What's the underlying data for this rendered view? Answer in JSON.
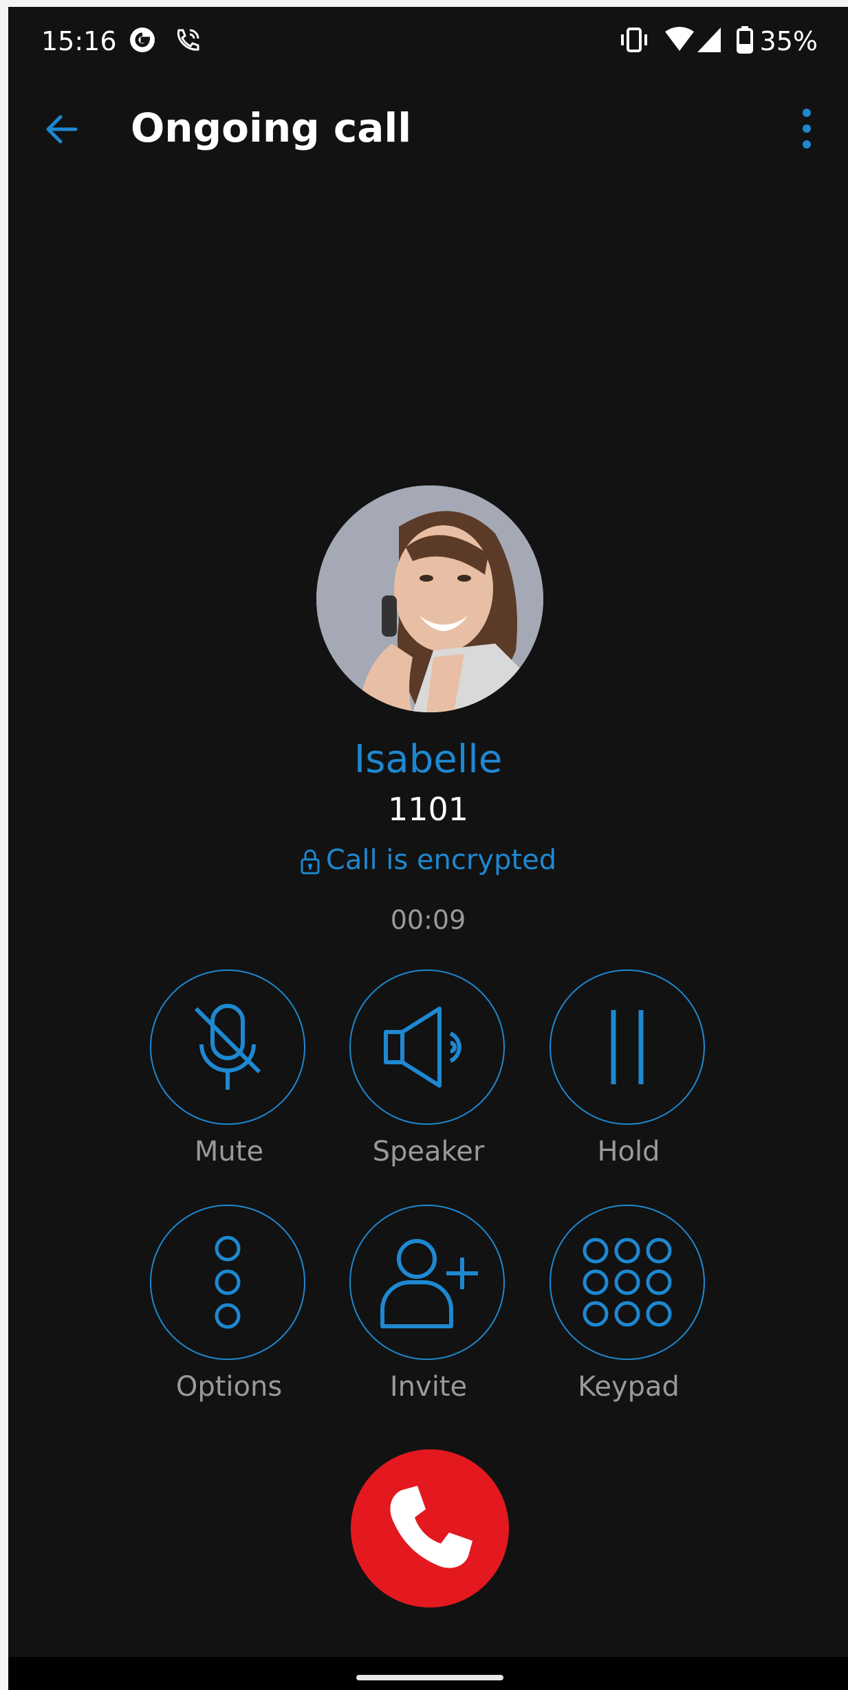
{
  "status_bar": {
    "time": "15:16",
    "battery": "35%",
    "icons": [
      "google-icon",
      "wifi-call-icon",
      "vibrate-icon",
      "wifi-icon",
      "signal-icon",
      "battery-icon"
    ]
  },
  "app_bar": {
    "title": "Ongoing call",
    "icons": [
      "back-arrow-icon",
      "more-vert-icon"
    ]
  },
  "contact": {
    "name": "Isabelle",
    "number": "1101",
    "encryption": "Call is encrypted",
    "duration": "00:09"
  },
  "controls": {
    "mute": "Mute",
    "speaker": "Speaker",
    "hold": "Hold",
    "options": "Options",
    "invite": "Invite",
    "keypad": "Keypad"
  },
  "colors": {
    "accent": "#1e88d1",
    "background": "#121212",
    "hangup": "#e3191f"
  }
}
